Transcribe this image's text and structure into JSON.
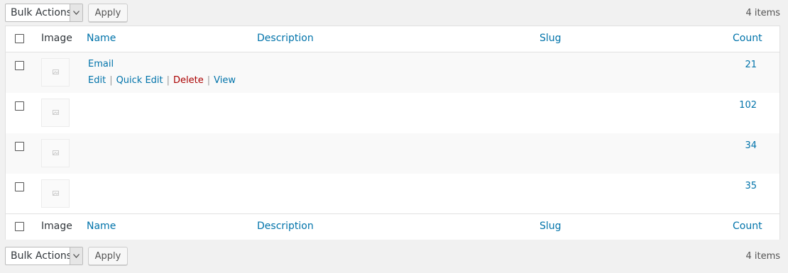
{
  "top_nav": {
    "bulk_label": "Bulk Actions",
    "apply_label": "Apply",
    "item_count": "4 items"
  },
  "bottom_nav": {
    "bulk_label": "Bulk Actions",
    "apply_label": "Apply",
    "item_count": "4 items"
  },
  "columns": {
    "image": "Image",
    "name": "Name",
    "description": "Description",
    "slug": "Slug",
    "count": "Count"
  },
  "rows": [
    {
      "name": "Email",
      "count": "21",
      "actions": {
        "edit": "Edit",
        "quick_edit": "Quick Edit",
        "delete": "Delete",
        "view": "View"
      }
    },
    {
      "name": "",
      "count": "102"
    },
    {
      "name": "",
      "count": "34"
    },
    {
      "name": "",
      "count": "35"
    }
  ],
  "colors": {
    "link": "#0073aa",
    "delete": "#aa0000",
    "header_text": "#32373c"
  }
}
